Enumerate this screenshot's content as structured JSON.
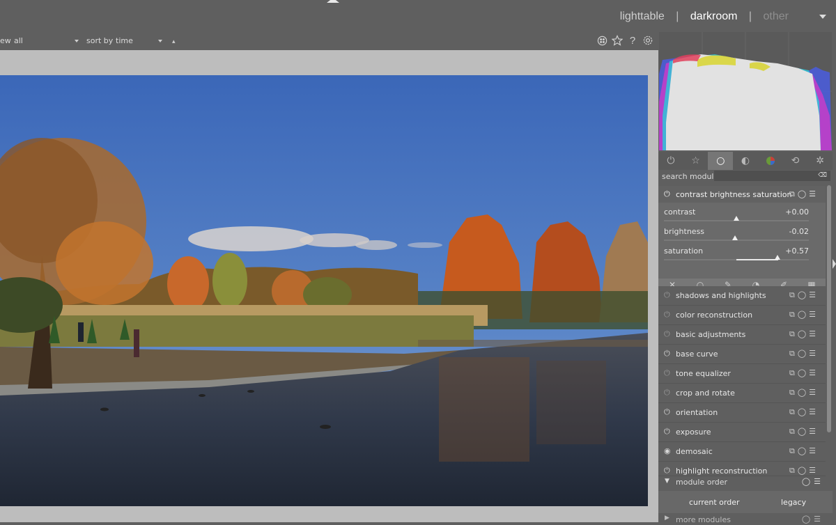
{
  "header": {
    "views": [
      "lighttable",
      "darkroom",
      "other"
    ],
    "active_view": "darkroom",
    "separator": "|"
  },
  "filterbar": {
    "view_label_partial": "ew",
    "view_value": "all",
    "sort_label": "sort by",
    "sort_value": "time",
    "sort_dir": "▴",
    "icons": [
      "color-labels-icon",
      "star-icon",
      "help-icon",
      "gear-icon"
    ]
  },
  "photo": {
    "description_colors": {
      "sky": "#3f6fbe",
      "foliage": "#c86a2a",
      "water": "#2b3344"
    }
  },
  "panel": {
    "module_groups": [
      "power-icon",
      "star-icon",
      "circle-icon",
      "tone-icon",
      "color-icon",
      "correct-icon",
      "effect-icon"
    ],
    "selected_group_index": 2,
    "search_label": "search module",
    "expanded_module": {
      "name": "contrast brightness saturation",
      "sliders": [
        {
          "label": "contrast",
          "value": "+0.00",
          "position": 0.5
        },
        {
          "label": "brightness",
          "value": "-0.02",
          "position": 0.49
        },
        {
          "label": "saturation",
          "value": "+0.57",
          "position": 0.79
        }
      ]
    },
    "blend_modes": [
      "off",
      "uniform",
      "drawn",
      "parametric",
      "drawn-parametric",
      "raster"
    ],
    "modules": [
      {
        "name": "shadows and highlights",
        "enabled": false
      },
      {
        "name": "color reconstruction",
        "enabled": false
      },
      {
        "name": "basic adjustments",
        "enabled": false
      },
      {
        "name": "base curve",
        "enabled": true
      },
      {
        "name": "tone equalizer",
        "enabled": false
      },
      {
        "name": "crop and rotate",
        "enabled": false
      },
      {
        "name": "orientation",
        "enabled": true
      },
      {
        "name": "exposure",
        "enabled": true
      },
      {
        "name": "demosaic",
        "enabled": true
      },
      {
        "name": "highlight reconstruction",
        "enabled": true
      }
    ],
    "module_order": {
      "label": "module order",
      "current": "current order",
      "preset": "legacy"
    },
    "more_modules": "more modules"
  }
}
